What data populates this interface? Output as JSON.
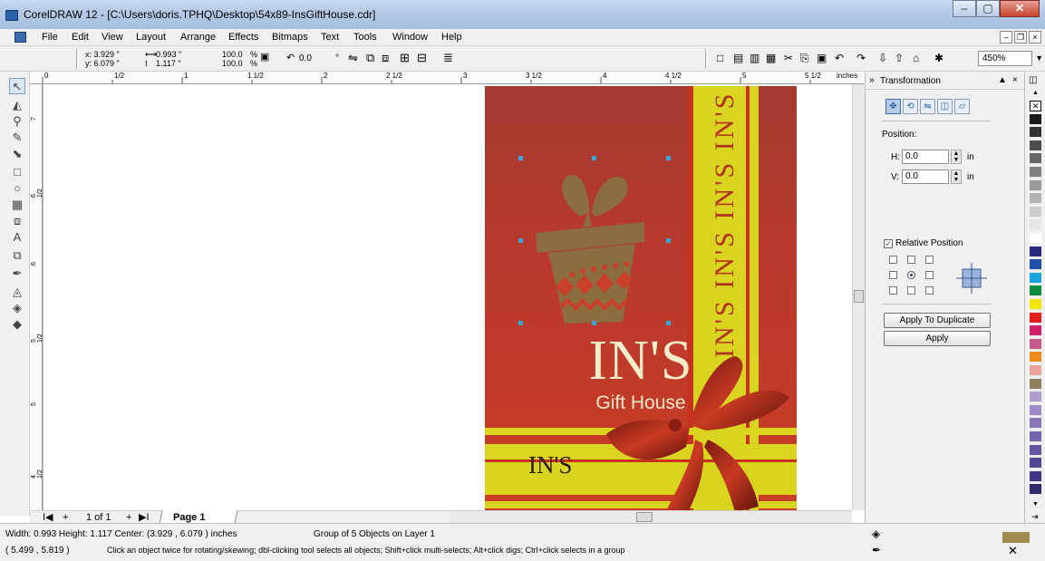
{
  "window": {
    "title": "CorelDRAW 12 - [C:\\Users\\doris.TPHQ\\Desktop\\54x89-InsGiftHouse.cdr]",
    "min": "–",
    "max": "▢",
    "close": "✕"
  },
  "menu": [
    {
      "label": "File"
    },
    {
      "label": "Edit"
    },
    {
      "label": "View"
    },
    {
      "label": "Layout"
    },
    {
      "label": "Arrange"
    },
    {
      "label": "Effects"
    },
    {
      "label": "Bitmaps"
    },
    {
      "label": "Text"
    },
    {
      "label": "Tools"
    },
    {
      "label": "Window"
    },
    {
      "label": "Help"
    }
  ],
  "propbar": {
    "x": "x: 3.929 \"",
    "y": "y: 6.079 \"",
    "w": "0.993 \"",
    "h": "1.117 \"",
    "sx": "100.0",
    "sy": "100.0",
    "pct": "%",
    "angle": "0.0",
    "deg": "°",
    "zoom": "450%"
  },
  "ruler": {
    "h": [
      "0",
      "1/2",
      "1",
      "1 1/2",
      "2",
      "2 1/2",
      "3",
      "3 1/2",
      "4",
      "4 1/2",
      "5",
      "5 1/2",
      "inches"
    ],
    "v": [
      "7",
      "6 1/2",
      "6",
      "5 1/2",
      "5",
      "4 1/2",
      "inches"
    ]
  },
  "card": {
    "vertical_text": "IN'S IN'S IN'S IN'S",
    "brand": "IN'S",
    "subtitle": "Gift House",
    "brand_small": "IN'S",
    "colors": {
      "red": "#b93a2d",
      "yellow": "#d8d41f",
      "gift": "#8b6d3f",
      "cream": "#f5ecc9"
    }
  },
  "pagenav": {
    "first": "I◀",
    "add_before": "+",
    "count": "1 of 1",
    "add_after": "+",
    "last": "▶I",
    "tab": "Page 1"
  },
  "docker": {
    "title": "Transformation",
    "position_label": "Position:",
    "h_label": "H:",
    "h_value": "0.0",
    "h_unit": "in",
    "v_label": "V:",
    "v_value": "0.0",
    "v_unit": "in",
    "relative_label": "Relative Position",
    "apply_dup": "Apply To Duplicate",
    "apply": "Apply"
  },
  "palette": [
    "#ffffff",
    "#1a1a1a",
    "#333333",
    "#4d4d4d",
    "#666666",
    "#808080",
    "#999999",
    "#b3b3b3",
    "#cccccc",
    "#e6e6e6",
    "#ffffff",
    "#2b2a7e",
    "#1f4ea6",
    "#1aa3dc",
    "#0f8a3c",
    "#f2e500",
    "#e11d1d",
    "#d21f6a",
    "#c65a8b",
    "#f08a1c",
    "#e8a39b",
    "#8f7f5f",
    "#b09ecf",
    "#9c8bc4",
    "#8977b9",
    "#7564ad",
    "#6554a0",
    "#554693",
    "#443686",
    "#2f2a6a"
  ],
  "status": {
    "dims": "Width: 0.993  Height: 1.117  Center: (3.929 , 6.079 )  inches",
    "obj": "Group of 5 Objects on Layer 1",
    "coords": "( 5.499 , 5.819 )",
    "hint": "Click an object twice for rotating/skewing; dbl-clicking tool selects all objects; Shift+click multi-selects; Alt+click digs; Ctrl+click selects in a group",
    "fill_color": "#a08a4f"
  }
}
